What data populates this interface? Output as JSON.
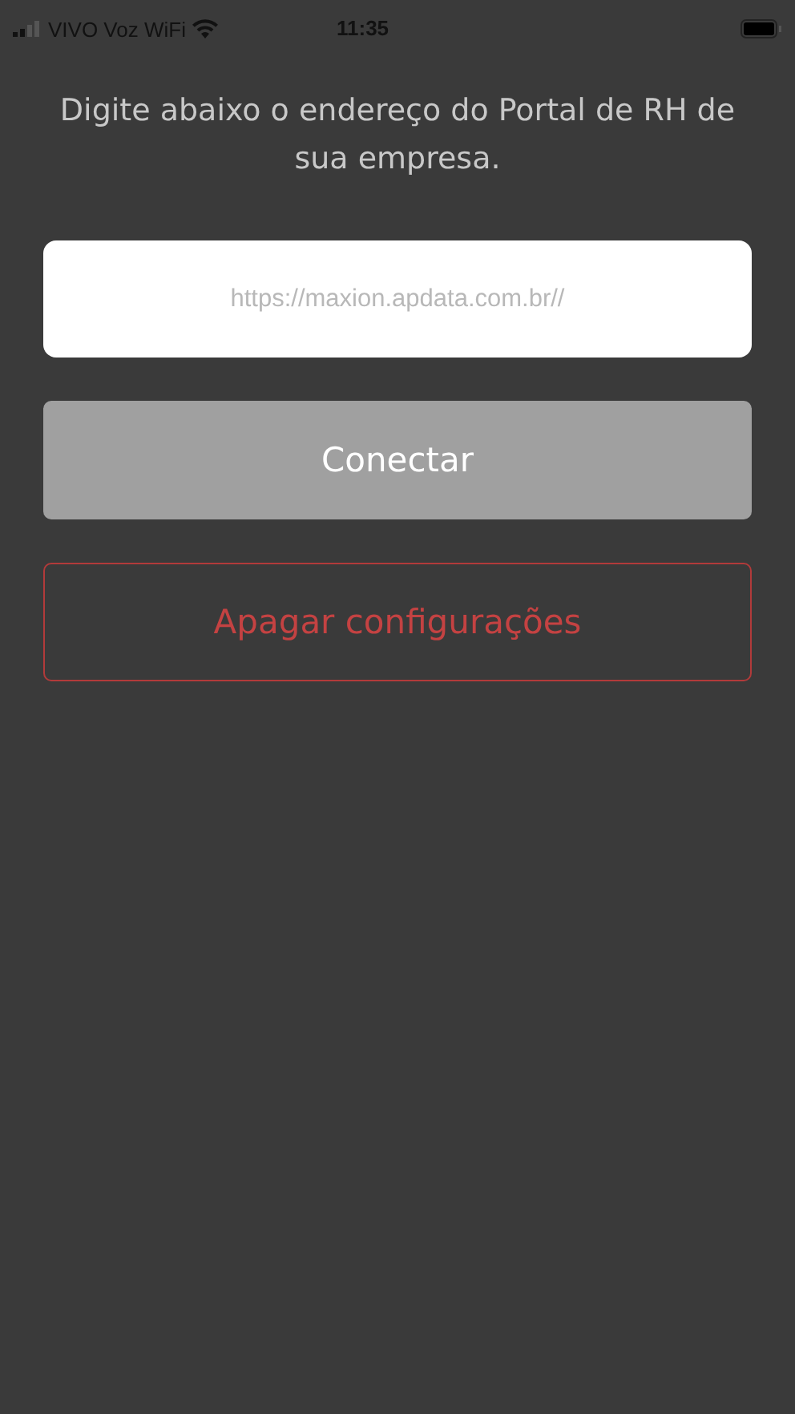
{
  "status_bar": {
    "carrier": "VIVO Voz WiFi",
    "time": "11:35"
  },
  "instruction": "Digite abaixo o endereço do Portal de RH de sua empresa.",
  "url_field": {
    "placeholder": "https://maxion.apdata.com.br//"
  },
  "buttons": [
    {
      "kind": "filled",
      "label": "Conectar"
    },
    {
      "kind": "outline",
      "label": "Apagar configurações"
    }
  ]
}
